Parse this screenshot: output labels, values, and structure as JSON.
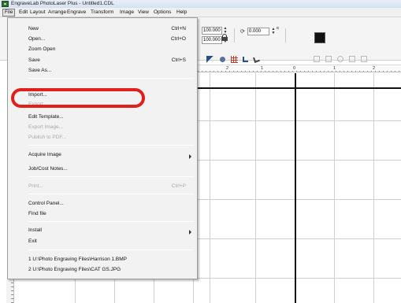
{
  "window": {
    "title": "EngraveLab PhotoLaser Plus - Untitled1.CDL"
  },
  "menubar": {
    "items": [
      "File",
      "Edit",
      "Layout",
      "Arrange",
      "Engrave",
      "Transform",
      "Image",
      "View",
      "Options",
      "Help"
    ]
  },
  "toolbar": {
    "width_value": "100.000",
    "height_value": "100.000",
    "rotation_value": "0.000",
    "degree_symbol": "o",
    "colors": {
      "swatch": "#111111"
    }
  },
  "ruler": {
    "labels": [
      "2",
      "1",
      "0",
      "1",
      "2"
    ]
  },
  "file_menu": {
    "items": [
      {
        "label": "New",
        "shortcut": "Ctrl+N",
        "enabled": true
      },
      {
        "label": "Open...",
        "shortcut": "Ctrl+O",
        "enabled": true
      },
      {
        "label": "Zoom Open",
        "shortcut": "",
        "enabled": true
      },
      {
        "label": "Save",
        "shortcut": "Ctrl+S",
        "enabled": true
      },
      {
        "label": "Save As...",
        "shortcut": "",
        "enabled": true
      },
      {
        "label": "Import...",
        "shortcut": "",
        "enabled": true
      },
      {
        "label": "Export...",
        "shortcut": "",
        "enabled": false
      },
      {
        "label": "Edit Template...",
        "shortcut": "",
        "enabled": true
      },
      {
        "label": "Export Image...",
        "shortcut": "",
        "enabled": false
      },
      {
        "label": "Publish to PDF...",
        "shortcut": "",
        "enabled": false
      },
      {
        "label": "Acquire Image",
        "shortcut": "",
        "enabled": true,
        "submenu": true
      },
      {
        "label": "Job/Cost Notes...",
        "shortcut": "",
        "enabled": true
      },
      {
        "label": "Print...",
        "shortcut": "Ctrl+P",
        "enabled": false
      },
      {
        "label": "Control Panel...",
        "shortcut": "",
        "enabled": true
      },
      {
        "label": "Find file",
        "shortcut": "",
        "enabled": true
      },
      {
        "label": "Install",
        "shortcut": "",
        "enabled": true,
        "submenu": true
      },
      {
        "label": "Exit",
        "shortcut": "",
        "enabled": true
      },
      {
        "label": "1 U:\\Photo Engraving Files\\Harrison 1.BMP",
        "shortcut": "",
        "enabled": true
      },
      {
        "label": "2 U:\\Photo Engraving Files\\CAT GS.JPG",
        "shortcut": "",
        "enabled": true
      }
    ]
  },
  "annotation": {
    "highlight_color": "#e0201c"
  }
}
